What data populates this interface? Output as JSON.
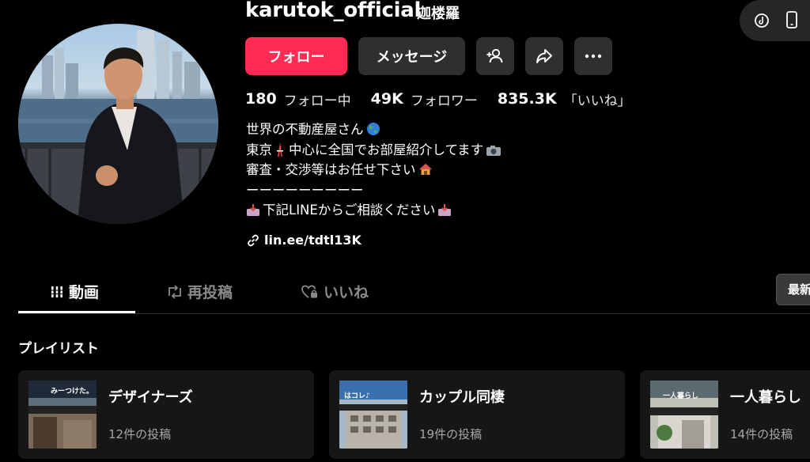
{
  "profile": {
    "username": "karutok_official",
    "nickname": "迦楼羅"
  },
  "actions": {
    "follow_label": "フォロー",
    "message_label": "メッセージ"
  },
  "stats": [
    {
      "value": "180",
      "label": "フォロー中"
    },
    {
      "value": "49K",
      "label": "フォロワー"
    },
    {
      "value": "835.3K",
      "label": "「いいね」"
    }
  ],
  "bio": {
    "lines": [
      "世界の不動産屋さん",
      "東京",
      "中心に全国でお部屋紹介してます",
      "審査・交渉等はお任せ下さい",
      "ーーーーーーーーー",
      "下記LINEからご相談ください"
    ],
    "link": "lin.ee/tdtl13K"
  },
  "tabs": [
    {
      "label": "動画",
      "active": true
    },
    {
      "label": "再投稿",
      "active": false
    },
    {
      "label": "いいね",
      "active": false
    }
  ],
  "sort_label": "最新",
  "playlists": {
    "heading": "プレイリスト",
    "items": [
      {
        "title": "デザイナーズ",
        "count": "12件の投稿",
        "thumb_text": "みーつけた。"
      },
      {
        "title": "カップル同棲",
        "count": "19件の投稿",
        "thumb_text": "はコレ♪"
      },
      {
        "title": "一人暮らし",
        "count": "14件の投稿",
        "thumb_text": "一人暮らし"
      }
    ]
  },
  "colors": {
    "accent": "#fe2c55",
    "background": "#000000",
    "button_bg": "#2f2f2f"
  }
}
